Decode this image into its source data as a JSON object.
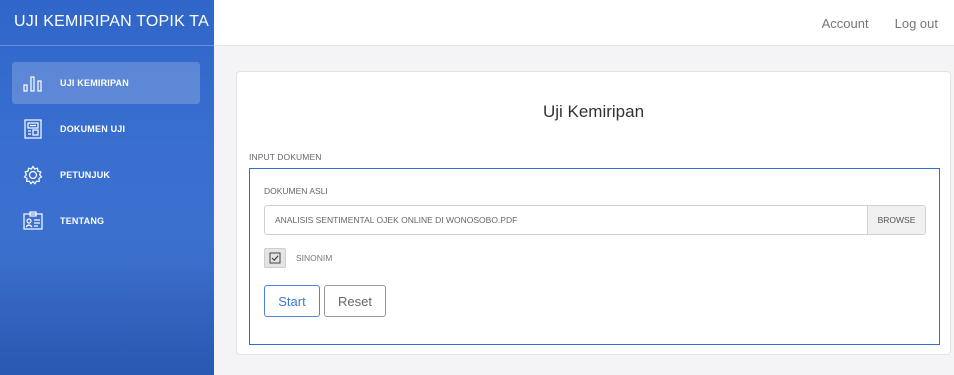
{
  "app": {
    "title": "UJI KEMIRIPAN TOPIK TA"
  },
  "topbar": {
    "account_label": "Account",
    "logout_label": "Log out"
  },
  "sidebar": {
    "items": [
      {
        "label": "UJI KEMIRIPAN",
        "icon": "bar-chart-icon",
        "active": true
      },
      {
        "label": "DOKUMEN UJI",
        "icon": "document-icon",
        "active": false
      },
      {
        "label": "PETUNJUK",
        "icon": "gear-icon",
        "active": false
      },
      {
        "label": "TENTANG",
        "icon": "id-card-icon",
        "active": false
      }
    ]
  },
  "main": {
    "title": "Uji Kemiripan",
    "section_label": "INPUT DOKUMEN",
    "document": {
      "label": "DOKUMEN ASLI",
      "value": "ANALISIS SENTIMENTAL OJEK ONLINE DI WONOSOBO.PDF",
      "browse_label": "BROWSE"
    },
    "synonym": {
      "label": "SINONIM",
      "checked": true
    },
    "start_label": "Start",
    "reset_label": "Reset"
  },
  "colors": {
    "sidebar": "#3a6fd0",
    "accent": "#2f6fd0",
    "start_text": "#3a78d8"
  }
}
